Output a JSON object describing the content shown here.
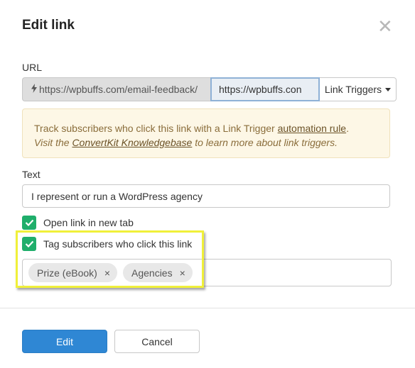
{
  "dialog": {
    "title": "Edit link",
    "close_icon": "close-icon"
  },
  "url": {
    "label": "URL",
    "prefix_icon": "bolt-icon",
    "prefix_text": "https://wpbuffs.com/email-feedback/",
    "input_value": "https://wpbuffs.con",
    "triggers_label": "Link Triggers"
  },
  "notice": {
    "line1_text": "Track subscribers who click this link with a Link Trigger ",
    "line1_link": "automation rule",
    "line1_end": ".",
    "line2_text": "Visit the ",
    "line2_link": "ConvertKit Knowledgebase",
    "line2_end": " to learn more about link triggers."
  },
  "text": {
    "label": "Text",
    "value": "I represent or run a WordPress agency"
  },
  "options": {
    "open_new_tab": {
      "label": "Open link in new tab",
      "checked": true
    },
    "tag_subscribers": {
      "label": "Tag subscribers who click this link",
      "checked": true
    }
  },
  "tags": [
    {
      "label": "Prize (eBook)",
      "remove": "×"
    },
    {
      "label": "Agencies",
      "remove": "×"
    }
  ],
  "footer": {
    "edit_label": "Edit",
    "cancel_label": "Cancel"
  },
  "colors": {
    "primary": "#2f87d4",
    "checkbox": "#1fae6b",
    "highlight": "#f0f03a",
    "notice_bg": "#fdf7e6",
    "notice_text": "#8a6d3b"
  }
}
